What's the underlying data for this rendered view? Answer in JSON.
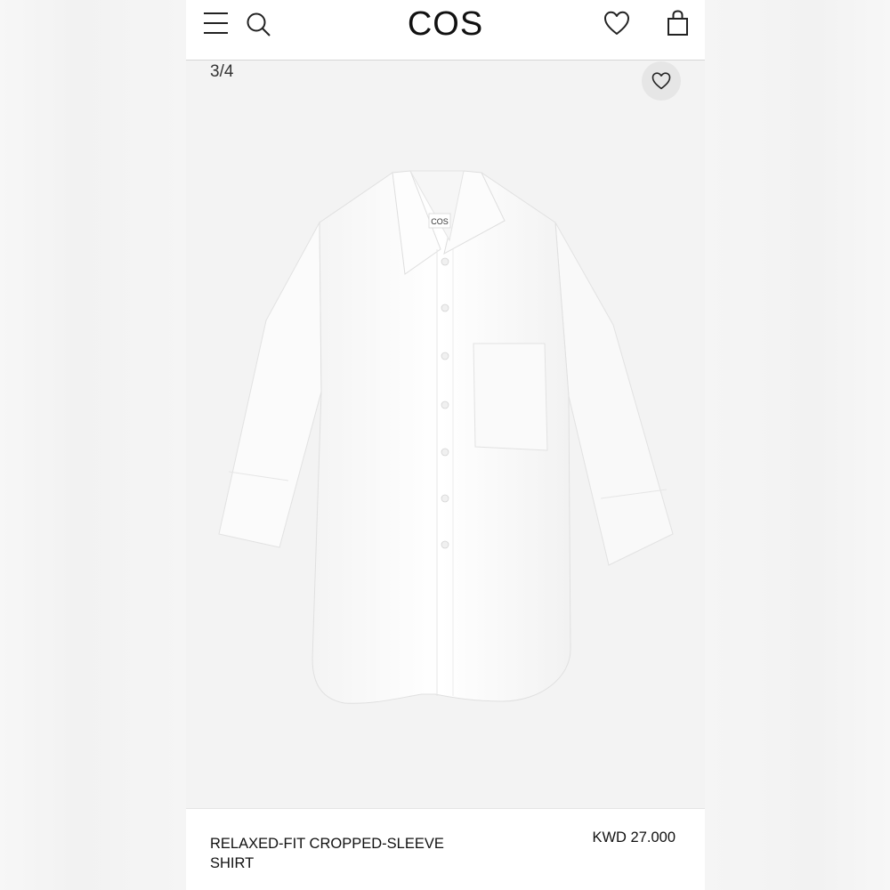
{
  "header": {
    "logo": "COS",
    "menu_icon": "hamburger-menu-icon",
    "search_icon": "search-icon",
    "wishlist_icon": "heart-icon",
    "bag_icon": "shopping-bag-icon"
  },
  "gallery": {
    "counter": "3/4",
    "favorite_icon": "heart-icon",
    "image_icon": "shirt-product-image",
    "label_text": "COS"
  },
  "product": {
    "name": "RELAXED-FIT CROPPED-SLEEVE SHIRT",
    "price": "KWD 27.000"
  },
  "colors": {
    "background": "#f3f3f3",
    "header": "#ffffff",
    "text": "#111111",
    "favorite_button": "#e6e6e6"
  }
}
